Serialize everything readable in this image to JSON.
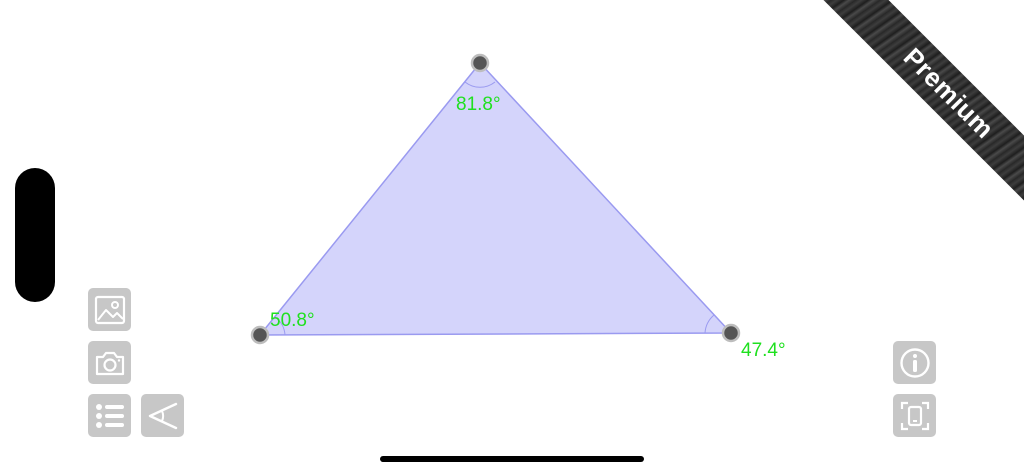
{
  "banner": {
    "label": "Premium"
  },
  "triangle": {
    "angles": {
      "top": "81.8°",
      "left": "50.8°",
      "right": "47.4°"
    },
    "fill_color": "#d4d4fb",
    "stroke_color": "#9a9af0",
    "label_color": "#1fe01f"
  },
  "toolbar_left": [
    {
      "name": "image-icon"
    },
    {
      "name": "camera-icon"
    },
    {
      "name": "list-icon"
    },
    {
      "name": "angle-tool-icon"
    }
  ],
  "toolbar_right": [
    {
      "name": "info-icon"
    },
    {
      "name": "screen-capture-icon"
    }
  ],
  "colors": {
    "button_bg": "#c7c7c7",
    "button_fg": "#ffffff"
  }
}
